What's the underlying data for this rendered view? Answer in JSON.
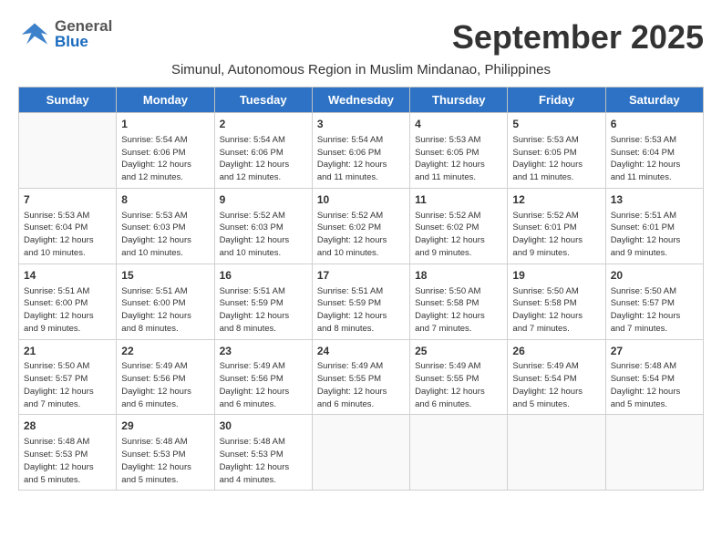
{
  "header": {
    "logo_general": "General",
    "logo_blue": "Blue",
    "month_title": "September 2025",
    "subtitle": "Simunul, Autonomous Region in Muslim Mindanao, Philippines"
  },
  "days_of_week": [
    "Sunday",
    "Monday",
    "Tuesday",
    "Wednesday",
    "Thursday",
    "Friday",
    "Saturday"
  ],
  "weeks": [
    [
      {
        "day": "",
        "sunrise": "",
        "sunset": "",
        "daylight": ""
      },
      {
        "day": "1",
        "sunrise": "Sunrise: 5:54 AM",
        "sunset": "Sunset: 6:06 PM",
        "daylight": "Daylight: 12 hours and 12 minutes."
      },
      {
        "day": "2",
        "sunrise": "Sunrise: 5:54 AM",
        "sunset": "Sunset: 6:06 PM",
        "daylight": "Daylight: 12 hours and 12 minutes."
      },
      {
        "day": "3",
        "sunrise": "Sunrise: 5:54 AM",
        "sunset": "Sunset: 6:06 PM",
        "daylight": "Daylight: 12 hours and 11 minutes."
      },
      {
        "day": "4",
        "sunrise": "Sunrise: 5:53 AM",
        "sunset": "Sunset: 6:05 PM",
        "daylight": "Daylight: 12 hours and 11 minutes."
      },
      {
        "day": "5",
        "sunrise": "Sunrise: 5:53 AM",
        "sunset": "Sunset: 6:05 PM",
        "daylight": "Daylight: 12 hours and 11 minutes."
      },
      {
        "day": "6",
        "sunrise": "Sunrise: 5:53 AM",
        "sunset": "Sunset: 6:04 PM",
        "daylight": "Daylight: 12 hours and 11 minutes."
      }
    ],
    [
      {
        "day": "7",
        "sunrise": "Sunrise: 5:53 AM",
        "sunset": "Sunset: 6:04 PM",
        "daylight": "Daylight: 12 hours and 10 minutes."
      },
      {
        "day": "8",
        "sunrise": "Sunrise: 5:53 AM",
        "sunset": "Sunset: 6:03 PM",
        "daylight": "Daylight: 12 hours and 10 minutes."
      },
      {
        "day": "9",
        "sunrise": "Sunrise: 5:52 AM",
        "sunset": "Sunset: 6:03 PM",
        "daylight": "Daylight: 12 hours and 10 minutes."
      },
      {
        "day": "10",
        "sunrise": "Sunrise: 5:52 AM",
        "sunset": "Sunset: 6:02 PM",
        "daylight": "Daylight: 12 hours and 10 minutes."
      },
      {
        "day": "11",
        "sunrise": "Sunrise: 5:52 AM",
        "sunset": "Sunset: 6:02 PM",
        "daylight": "Daylight: 12 hours and 9 minutes."
      },
      {
        "day": "12",
        "sunrise": "Sunrise: 5:52 AM",
        "sunset": "Sunset: 6:01 PM",
        "daylight": "Daylight: 12 hours and 9 minutes."
      },
      {
        "day": "13",
        "sunrise": "Sunrise: 5:51 AM",
        "sunset": "Sunset: 6:01 PM",
        "daylight": "Daylight: 12 hours and 9 minutes."
      }
    ],
    [
      {
        "day": "14",
        "sunrise": "Sunrise: 5:51 AM",
        "sunset": "Sunset: 6:00 PM",
        "daylight": "Daylight: 12 hours and 9 minutes."
      },
      {
        "day": "15",
        "sunrise": "Sunrise: 5:51 AM",
        "sunset": "Sunset: 6:00 PM",
        "daylight": "Daylight: 12 hours and 8 minutes."
      },
      {
        "day": "16",
        "sunrise": "Sunrise: 5:51 AM",
        "sunset": "Sunset: 5:59 PM",
        "daylight": "Daylight: 12 hours and 8 minutes."
      },
      {
        "day": "17",
        "sunrise": "Sunrise: 5:51 AM",
        "sunset": "Sunset: 5:59 PM",
        "daylight": "Daylight: 12 hours and 8 minutes."
      },
      {
        "day": "18",
        "sunrise": "Sunrise: 5:50 AM",
        "sunset": "Sunset: 5:58 PM",
        "daylight": "Daylight: 12 hours and 7 minutes."
      },
      {
        "day": "19",
        "sunrise": "Sunrise: 5:50 AM",
        "sunset": "Sunset: 5:58 PM",
        "daylight": "Daylight: 12 hours and 7 minutes."
      },
      {
        "day": "20",
        "sunrise": "Sunrise: 5:50 AM",
        "sunset": "Sunset: 5:57 PM",
        "daylight": "Daylight: 12 hours and 7 minutes."
      }
    ],
    [
      {
        "day": "21",
        "sunrise": "Sunrise: 5:50 AM",
        "sunset": "Sunset: 5:57 PM",
        "daylight": "Daylight: 12 hours and 7 minutes."
      },
      {
        "day": "22",
        "sunrise": "Sunrise: 5:49 AM",
        "sunset": "Sunset: 5:56 PM",
        "daylight": "Daylight: 12 hours and 6 minutes."
      },
      {
        "day": "23",
        "sunrise": "Sunrise: 5:49 AM",
        "sunset": "Sunset: 5:56 PM",
        "daylight": "Daylight: 12 hours and 6 minutes."
      },
      {
        "day": "24",
        "sunrise": "Sunrise: 5:49 AM",
        "sunset": "Sunset: 5:55 PM",
        "daylight": "Daylight: 12 hours and 6 minutes."
      },
      {
        "day": "25",
        "sunrise": "Sunrise: 5:49 AM",
        "sunset": "Sunset: 5:55 PM",
        "daylight": "Daylight: 12 hours and 6 minutes."
      },
      {
        "day": "26",
        "sunrise": "Sunrise: 5:49 AM",
        "sunset": "Sunset: 5:54 PM",
        "daylight": "Daylight: 12 hours and 5 minutes."
      },
      {
        "day": "27",
        "sunrise": "Sunrise: 5:48 AM",
        "sunset": "Sunset: 5:54 PM",
        "daylight": "Daylight: 12 hours and 5 minutes."
      }
    ],
    [
      {
        "day": "28",
        "sunrise": "Sunrise: 5:48 AM",
        "sunset": "Sunset: 5:53 PM",
        "daylight": "Daylight: 12 hours and 5 minutes."
      },
      {
        "day": "29",
        "sunrise": "Sunrise: 5:48 AM",
        "sunset": "Sunset: 5:53 PM",
        "daylight": "Daylight: 12 hours and 5 minutes."
      },
      {
        "day": "30",
        "sunrise": "Sunrise: 5:48 AM",
        "sunset": "Sunset: 5:53 PM",
        "daylight": "Daylight: 12 hours and 4 minutes."
      },
      {
        "day": "",
        "sunrise": "",
        "sunset": "",
        "daylight": ""
      },
      {
        "day": "",
        "sunrise": "",
        "sunset": "",
        "daylight": ""
      },
      {
        "day": "",
        "sunrise": "",
        "sunset": "",
        "daylight": ""
      },
      {
        "day": "",
        "sunrise": "",
        "sunset": "",
        "daylight": ""
      }
    ]
  ]
}
